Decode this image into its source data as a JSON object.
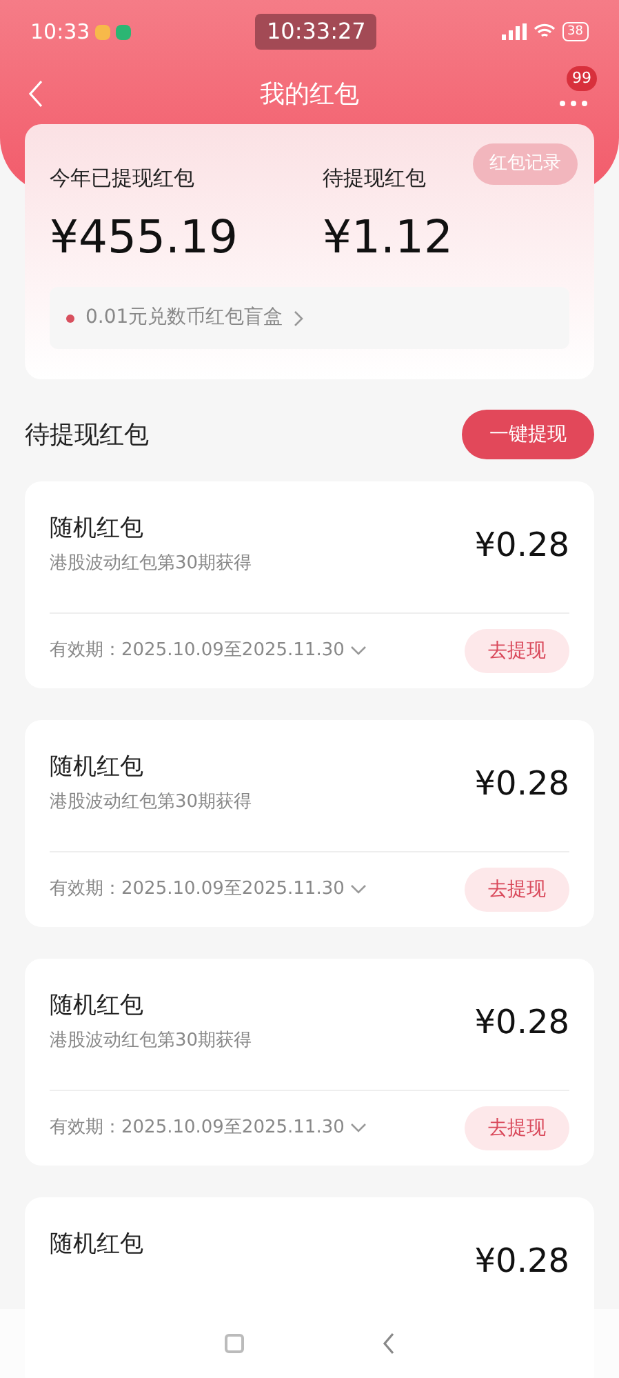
{
  "status_bar": {
    "time": "10:33",
    "clock": "10:33:27",
    "battery": "38"
  },
  "header": {
    "title": "我的红包",
    "badge": "99"
  },
  "summary": {
    "record_button": "红包记录",
    "withdrawn_label": "今年已提现红包",
    "withdrawn_amount": "¥455.19",
    "pending_label": "待提现红包",
    "pending_amount": "¥1.12",
    "promo": "0.01元兑数币红包盲盒"
  },
  "section": {
    "title": "待提现红包",
    "button": "一键提现"
  },
  "cards": [
    {
      "title": "随机红包",
      "subtitle": "港股波动红包第30期获得",
      "amount": "¥0.28",
      "validity": "有效期：2025.10.09至2025.11.30",
      "button": "去提现"
    },
    {
      "title": "随机红包",
      "subtitle": "港股波动红包第30期获得",
      "amount": "¥0.28",
      "validity": "有效期：2025.10.09至2025.11.30",
      "button": "去提现"
    },
    {
      "title": "随机红包",
      "subtitle": "港股波动红包第30期获得",
      "amount": "¥0.28",
      "validity": "有效期：2025.10.09至2025.11.30",
      "button": "去提现"
    },
    {
      "title": "随机红包",
      "amount": "¥0.28"
    }
  ]
}
